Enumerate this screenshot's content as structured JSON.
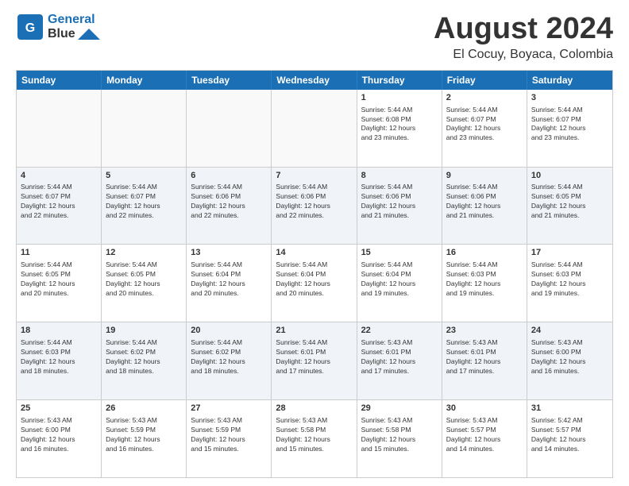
{
  "header": {
    "logo_line1": "General",
    "logo_line2": "Blue",
    "title": "August 2024",
    "location": "El Cocuy, Boyaca, Colombia"
  },
  "weekdays": [
    "Sunday",
    "Monday",
    "Tuesday",
    "Wednesday",
    "Thursday",
    "Friday",
    "Saturday"
  ],
  "rows": [
    [
      {
        "day": "",
        "text": "",
        "empty": true
      },
      {
        "day": "",
        "text": "",
        "empty": true
      },
      {
        "day": "",
        "text": "",
        "empty": true
      },
      {
        "day": "",
        "text": "",
        "empty": true
      },
      {
        "day": "1",
        "text": "Sunrise: 5:44 AM\nSunset: 6:08 PM\nDaylight: 12 hours\nand 23 minutes."
      },
      {
        "day": "2",
        "text": "Sunrise: 5:44 AM\nSunset: 6:07 PM\nDaylight: 12 hours\nand 23 minutes."
      },
      {
        "day": "3",
        "text": "Sunrise: 5:44 AM\nSunset: 6:07 PM\nDaylight: 12 hours\nand 23 minutes."
      }
    ],
    [
      {
        "day": "4",
        "text": "Sunrise: 5:44 AM\nSunset: 6:07 PM\nDaylight: 12 hours\nand 22 minutes."
      },
      {
        "day": "5",
        "text": "Sunrise: 5:44 AM\nSunset: 6:07 PM\nDaylight: 12 hours\nand 22 minutes."
      },
      {
        "day": "6",
        "text": "Sunrise: 5:44 AM\nSunset: 6:06 PM\nDaylight: 12 hours\nand 22 minutes."
      },
      {
        "day": "7",
        "text": "Sunrise: 5:44 AM\nSunset: 6:06 PM\nDaylight: 12 hours\nand 22 minutes."
      },
      {
        "day": "8",
        "text": "Sunrise: 5:44 AM\nSunset: 6:06 PM\nDaylight: 12 hours\nand 21 minutes."
      },
      {
        "day": "9",
        "text": "Sunrise: 5:44 AM\nSunset: 6:06 PM\nDaylight: 12 hours\nand 21 minutes."
      },
      {
        "day": "10",
        "text": "Sunrise: 5:44 AM\nSunset: 6:05 PM\nDaylight: 12 hours\nand 21 minutes."
      }
    ],
    [
      {
        "day": "11",
        "text": "Sunrise: 5:44 AM\nSunset: 6:05 PM\nDaylight: 12 hours\nand 20 minutes."
      },
      {
        "day": "12",
        "text": "Sunrise: 5:44 AM\nSunset: 6:05 PM\nDaylight: 12 hours\nand 20 minutes."
      },
      {
        "day": "13",
        "text": "Sunrise: 5:44 AM\nSunset: 6:04 PM\nDaylight: 12 hours\nand 20 minutes."
      },
      {
        "day": "14",
        "text": "Sunrise: 5:44 AM\nSunset: 6:04 PM\nDaylight: 12 hours\nand 20 minutes."
      },
      {
        "day": "15",
        "text": "Sunrise: 5:44 AM\nSunset: 6:04 PM\nDaylight: 12 hours\nand 19 minutes."
      },
      {
        "day": "16",
        "text": "Sunrise: 5:44 AM\nSunset: 6:03 PM\nDaylight: 12 hours\nand 19 minutes."
      },
      {
        "day": "17",
        "text": "Sunrise: 5:44 AM\nSunset: 6:03 PM\nDaylight: 12 hours\nand 19 minutes."
      }
    ],
    [
      {
        "day": "18",
        "text": "Sunrise: 5:44 AM\nSunset: 6:03 PM\nDaylight: 12 hours\nand 18 minutes."
      },
      {
        "day": "19",
        "text": "Sunrise: 5:44 AM\nSunset: 6:02 PM\nDaylight: 12 hours\nand 18 minutes."
      },
      {
        "day": "20",
        "text": "Sunrise: 5:44 AM\nSunset: 6:02 PM\nDaylight: 12 hours\nand 18 minutes."
      },
      {
        "day": "21",
        "text": "Sunrise: 5:44 AM\nSunset: 6:01 PM\nDaylight: 12 hours\nand 17 minutes."
      },
      {
        "day": "22",
        "text": "Sunrise: 5:43 AM\nSunset: 6:01 PM\nDaylight: 12 hours\nand 17 minutes."
      },
      {
        "day": "23",
        "text": "Sunrise: 5:43 AM\nSunset: 6:01 PM\nDaylight: 12 hours\nand 17 minutes."
      },
      {
        "day": "24",
        "text": "Sunrise: 5:43 AM\nSunset: 6:00 PM\nDaylight: 12 hours\nand 16 minutes."
      }
    ],
    [
      {
        "day": "25",
        "text": "Sunrise: 5:43 AM\nSunset: 6:00 PM\nDaylight: 12 hours\nand 16 minutes."
      },
      {
        "day": "26",
        "text": "Sunrise: 5:43 AM\nSunset: 5:59 PM\nDaylight: 12 hours\nand 16 minutes."
      },
      {
        "day": "27",
        "text": "Sunrise: 5:43 AM\nSunset: 5:59 PM\nDaylight: 12 hours\nand 15 minutes."
      },
      {
        "day": "28",
        "text": "Sunrise: 5:43 AM\nSunset: 5:58 PM\nDaylight: 12 hours\nand 15 minutes."
      },
      {
        "day": "29",
        "text": "Sunrise: 5:43 AM\nSunset: 5:58 PM\nDaylight: 12 hours\nand 15 minutes."
      },
      {
        "day": "30",
        "text": "Sunrise: 5:43 AM\nSunset: 5:57 PM\nDaylight: 12 hours\nand 14 minutes."
      },
      {
        "day": "31",
        "text": "Sunrise: 5:42 AM\nSunset: 5:57 PM\nDaylight: 12 hours\nand 14 minutes."
      }
    ]
  ]
}
